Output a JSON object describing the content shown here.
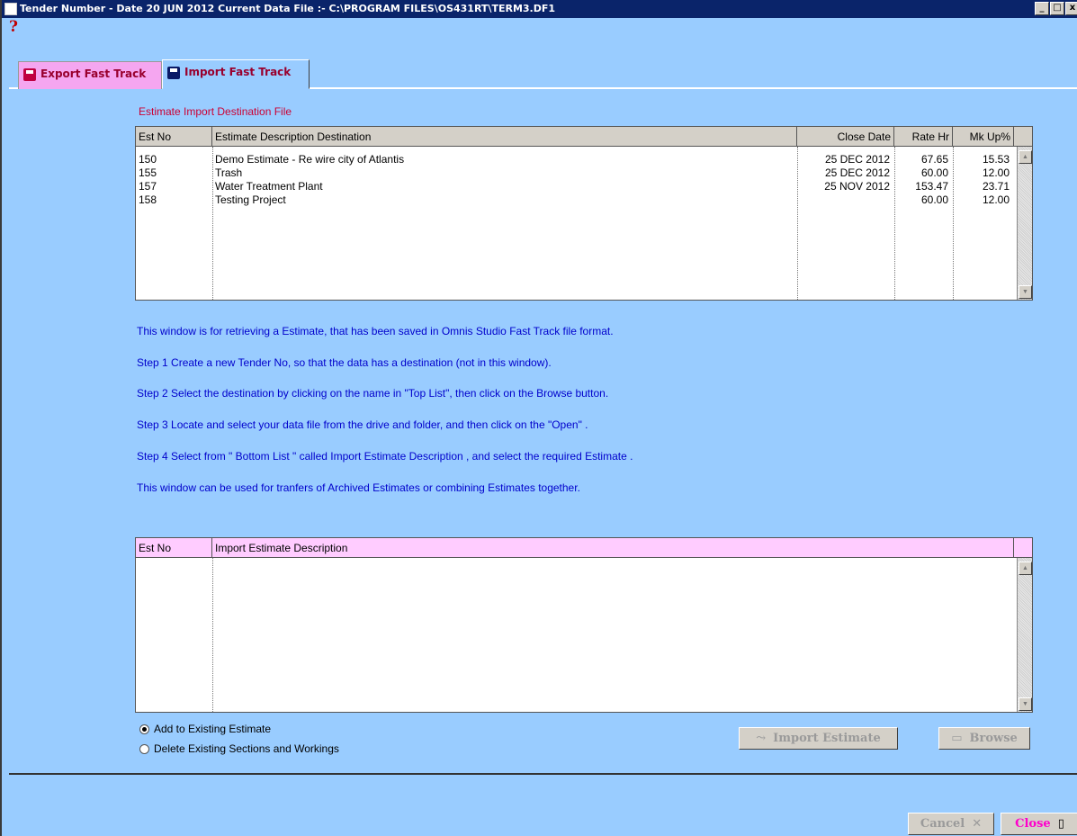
{
  "window": {
    "title": "Tender Number - Date 20 JUN 2012    Current Data File :- C:\\PROGRAM FILES\\OS431RT\\TERM3.DF1",
    "minimize_glyph": "_",
    "maximize_glyph": "□",
    "close_glyph": "x"
  },
  "help": {
    "glyph": "?",
    "icon": "question-mark-icon"
  },
  "tabs": [
    {
      "label": "Export Fast Track",
      "icon": "floppy-disk-icon",
      "active": false
    },
    {
      "label": "Import Fast Track",
      "icon": "floppy-disk-icon",
      "active": true
    }
  ],
  "destination": {
    "label": "Estimate Import Destination File",
    "columns": [
      "Est No",
      "Estimate Description Destination",
      "Close Date",
      "Rate Hr",
      "Mk Up%"
    ],
    "rows": [
      {
        "est_no": "150",
        "description": "Demo Estimate - Re wire city of Atlantis",
        "close_date": "25 DEC 2012",
        "rate_hr": "67.65",
        "mk_up": "15.53"
      },
      {
        "est_no": "155",
        "description": "Trash",
        "close_date": "25 DEC 2012",
        "rate_hr": "60.00",
        "mk_up": "12.00"
      },
      {
        "est_no": "157",
        "description": "Water Treatment Plant",
        "close_date": "25 NOV 2012",
        "rate_hr": "153.47",
        "mk_up": "23.71"
      },
      {
        "est_no": "158",
        "description": "Testing Project",
        "close_date": "",
        "rate_hr": "60.00",
        "mk_up": "12.00"
      }
    ]
  },
  "instructions": [
    "This window is for retrieving a Estimate, that has been saved in Omnis Studio Fast Track file format.",
    "Step 1 Create a new Tender No, so that  the data has a destination (not in this window).",
    "Step 2 Select the destination by clicking on the name in \"Top List\", then click on the Browse button.",
    "Step 3 Locate and select your data file from the drive and folder, and then click on the \"Open\" .",
    "Step 4 Select from \" Bottom List \" called Import Estimate Description , and select the required Estimate .",
    "This window can be used for tranfers of Archived  Estimates or combining Estimates together."
  ],
  "import_list": {
    "columns": [
      "Est No",
      "Import Estimate Description"
    ],
    "header_color": "#FFCCFF"
  },
  "options": [
    {
      "label": "Add to Existing Estimate",
      "selected": true
    },
    {
      "label": "Delete Existing Sections and Workings",
      "selected": false
    }
  ],
  "buttons": {
    "import_estimate": "Import Estimate",
    "browse": "Browse",
    "cancel": "Cancel",
    "close": "Close"
  },
  "colors": {
    "background": "#99CCFF",
    "title_bar": "#0A246A",
    "label_red": "#CC0033",
    "instruction_blue": "#0000CC",
    "close_text": "#FF00CC"
  }
}
